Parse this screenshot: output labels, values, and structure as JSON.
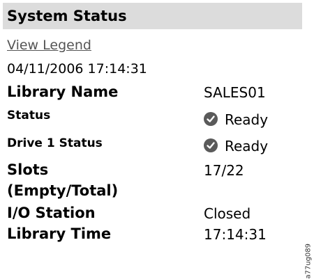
{
  "panel": {
    "title": "System Status",
    "legend_link": "View Legend",
    "timestamp": "04/11/2006 17:14:31"
  },
  "rows": {
    "library_name": {
      "label": "Library Name",
      "value": "SALES01"
    },
    "status": {
      "label": "Status",
      "value": "Ready",
      "icon": "check-circle-icon"
    },
    "drive1_status": {
      "label": "Drive 1 Status",
      "value": "Ready",
      "icon": "check-circle-icon"
    },
    "slots": {
      "label_line1": "Slots",
      "label_line2": "(Empty/Total)",
      "value": "17/22"
    },
    "io_station": {
      "label": "I/O Station",
      "value": "Closed"
    },
    "library_time": {
      "label": "Library Time",
      "value": "17:14:31"
    }
  },
  "side_code": "a77ug089",
  "colors": {
    "header_bg": "#dcdcdc",
    "link": "#555555",
    "icon": "#5a5a5a"
  }
}
